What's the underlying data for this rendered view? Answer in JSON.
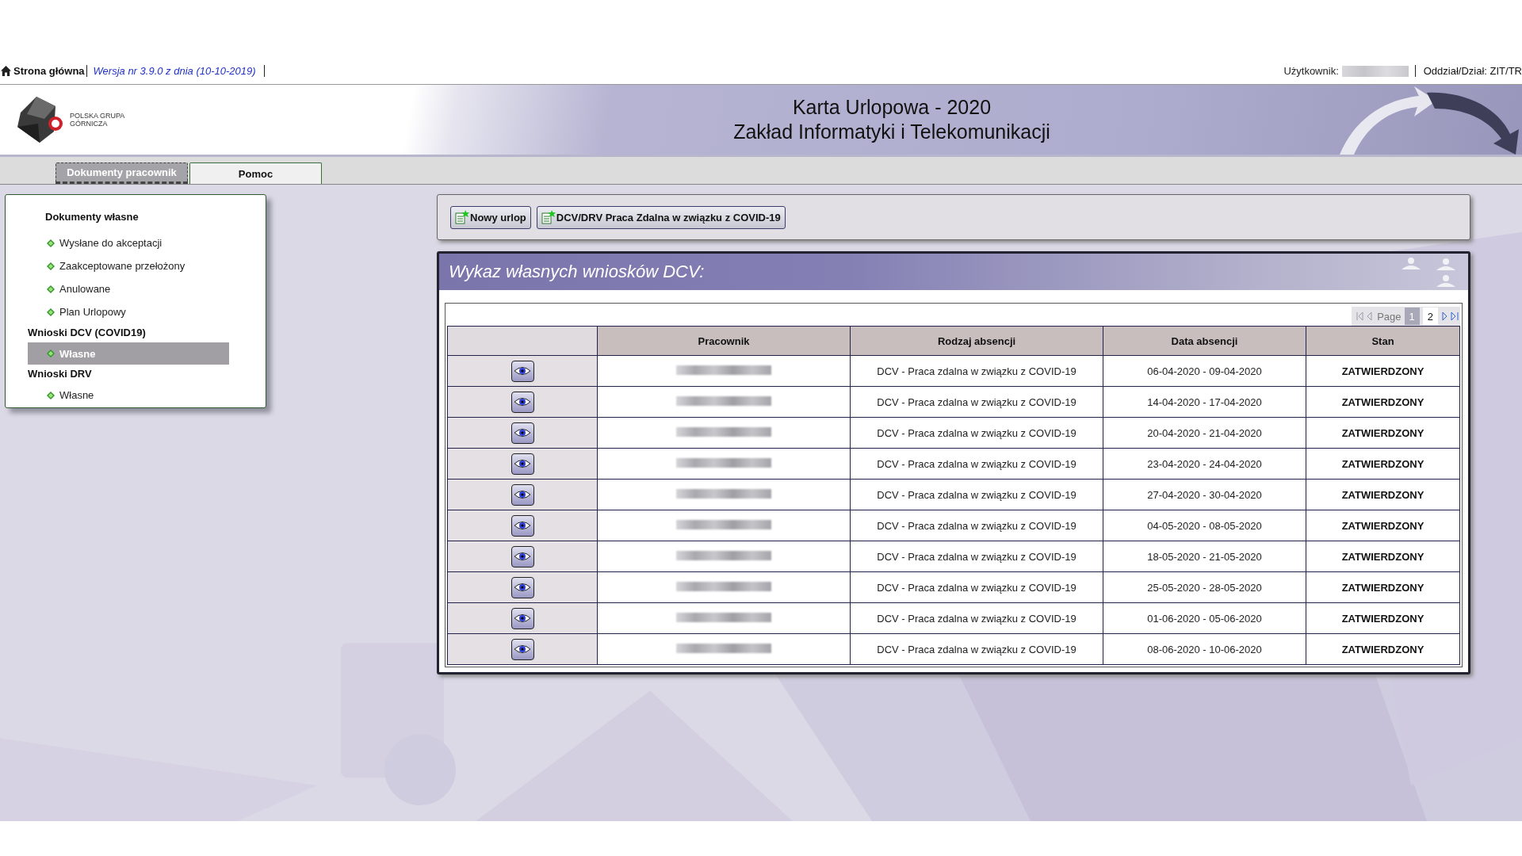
{
  "top_bar": {
    "home_link": "Strona główna",
    "version": "Wersja nr 3.9.0 z dnia (10-10-2019)",
    "user_label": "Użytkownik:",
    "department": "Oddział/Dział: ZIT/TR"
  },
  "header": {
    "logo_lines": [
      "POLSKA GRUPA",
      "GÓRNICZA"
    ],
    "title": "Karta Urlopowa - 2020",
    "subtitle": "Zakład Informatyki i Telekomunikacji"
  },
  "tabs": [
    {
      "label": "Dokumenty pracownik",
      "selected": true
    },
    {
      "label": "Pomoc",
      "selected": false
    }
  ],
  "sidebar": {
    "groups": [
      {
        "label": "Dokumenty własne",
        "children": [
          {
            "label": "Wysłane do akceptacji",
            "selected": false
          },
          {
            "label": "Zaakceptowane przełożony",
            "selected": false
          },
          {
            "label": "Anulowane",
            "selected": false
          },
          {
            "label": "Plan Urlopowy",
            "selected": false
          }
        ]
      },
      {
        "label": "Wnioski DCV (COVID19)",
        "children": [
          {
            "label": "Własne",
            "selected": true
          }
        ]
      },
      {
        "label": "Wnioski DRV",
        "children": [
          {
            "label": "Własne",
            "selected": false
          }
        ]
      }
    ]
  },
  "toolbar": {
    "buttons": [
      "Nowy urlop",
      "DCV/DRV Praca Zdalna w związku z COVID-19"
    ]
  },
  "panel": {
    "title": "Wykaz własnych wniosków DCV:",
    "pagination": {
      "label": "Page",
      "pages": [
        {
          "label": "1",
          "selected": true
        },
        {
          "label": "2",
          "selected": false
        }
      ]
    },
    "columns": [
      "Pracownik",
      "Rodzaj absencji",
      "Data absencji",
      "Stan"
    ],
    "rows": [
      {
        "type": "DCV - Praca zdalna w związku z COVID-19",
        "dates": "06-04-2020 - 09-04-2020",
        "status": "ZATWIERDZONY"
      },
      {
        "type": "DCV - Praca zdalna w związku z COVID-19",
        "dates": "14-04-2020 - 17-04-2020",
        "status": "ZATWIERDZONY"
      },
      {
        "type": "DCV - Praca zdalna w związku z COVID-19",
        "dates": "20-04-2020 - 21-04-2020",
        "status": "ZATWIERDZONY"
      },
      {
        "type": "DCV - Praca zdalna w związku z COVID-19",
        "dates": "23-04-2020 - 24-04-2020",
        "status": "ZATWIERDZONY"
      },
      {
        "type": "DCV - Praca zdalna w związku z COVID-19",
        "dates": "27-04-2020 - 30-04-2020",
        "status": "ZATWIERDZONY"
      },
      {
        "type": "DCV - Praca zdalna w związku z COVID-19",
        "dates": "04-05-2020 - 08-05-2020",
        "status": "ZATWIERDZONY"
      },
      {
        "type": "DCV - Praca zdalna w związku z COVID-19",
        "dates": "18-05-2020 - 21-05-2020",
        "status": "ZATWIERDZONY"
      },
      {
        "type": "DCV - Praca zdalna w związku z COVID-19",
        "dates": "25-05-2020 - 28-05-2020",
        "status": "ZATWIERDZONY"
      },
      {
        "type": "DCV - Praca zdalna w związku z COVID-19",
        "dates": "01-06-2020 - 05-06-2020",
        "status": "ZATWIERDZONY"
      },
      {
        "type": "DCV - Praca zdalna w związku z COVID-19",
        "dates": "08-06-2020 - 10-06-2020",
        "status": "ZATWIERDZONY"
      }
    ]
  }
}
